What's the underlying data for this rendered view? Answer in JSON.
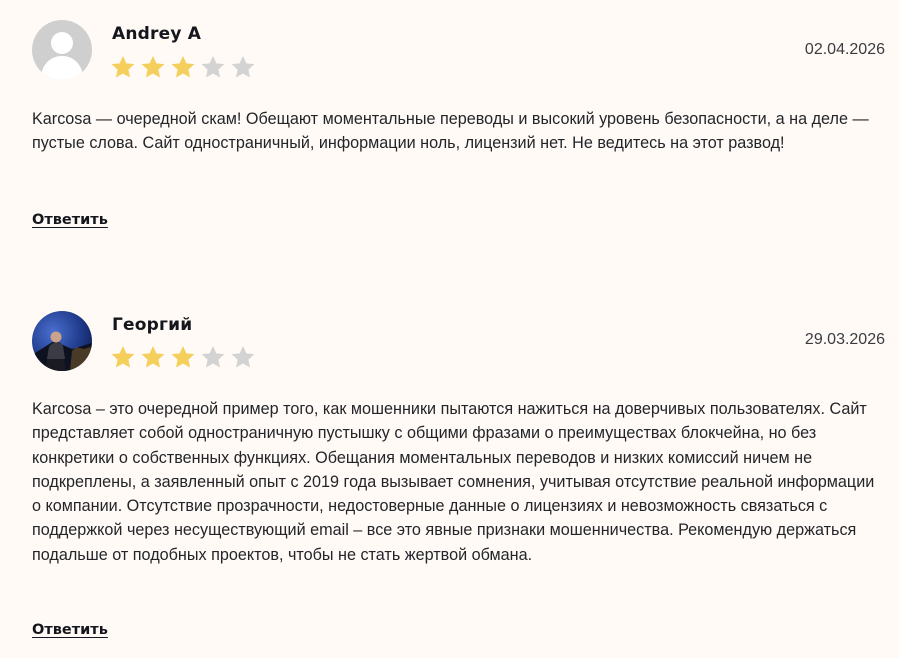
{
  "reviews": [
    {
      "author": "Andrey A",
      "rating": 3,
      "max_rating": 5,
      "date": "02.04.2026",
      "text": "Karcosa — очередной скам! Обещают моментальные переводы и высокий уровень безопасности, а на деле — пустые слова. Сайт одностраничный, информации ноль, лицензий нет. Не ведитесь на этот развод!",
      "reply_label": "Ответить",
      "avatar": "default-user-avatar"
    },
    {
      "author": "Георгий",
      "rating": 3,
      "max_rating": 5,
      "date": "29.03.2026",
      "text": "Karcosa – это очередной пример того, как мошенники пытаются нажиться на доверчивых пользователях. Сайт представляет собой одностраничную пустышку с общими фразами о преимуществах блокчейна, но без конкретики о собственных функциях. Обещания моментальных переводов и низких комиссий ничем не подкреплены, а заявленный опыт с 2019 года вызывает сомнения, учитывая отсутствие реальной информации о компании. Отсутствие прозрачности, недостоверные данные о лицензиях и невозможность связаться с поддержкой через несуществующий email – все это явные признаки мошенничества. Рекомендую держаться подальше от подобных проектов, чтобы не стать жертвой обмана.",
      "reply_label": "Ответить",
      "avatar": "user-photo-avatar"
    }
  ],
  "colors": {
    "background": "#fffaf5",
    "star_filled": "#f5cf5b",
    "star_empty": "#d3d3d3",
    "text": "#23252a",
    "default_avatar_bg": "#cfcfcf"
  }
}
